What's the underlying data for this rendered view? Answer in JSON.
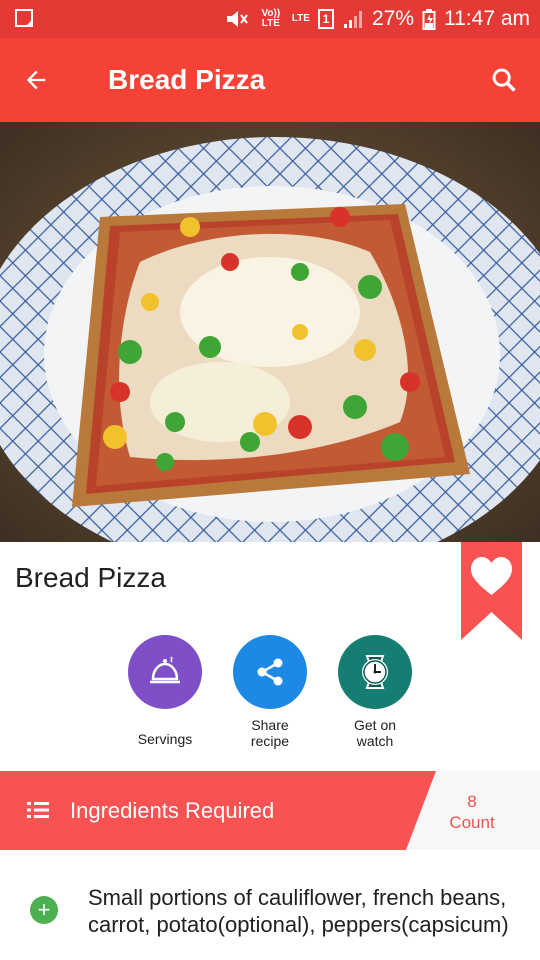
{
  "status_bar": {
    "volte": "Vo)) LTE",
    "lte": "LTE",
    "sim": "1",
    "battery": "27%",
    "time": "11:47 am"
  },
  "app_bar": {
    "title": "Bread Pizza"
  },
  "recipe": {
    "title": "Bread Pizza"
  },
  "actions": {
    "servings": "Servings",
    "share": "Share recipe",
    "watch": "Get on watch"
  },
  "ingredients": {
    "header": "Ingredients Required",
    "count_value": "8",
    "count_label": "Count",
    "items": [
      "Small portions of cauliflower, french beans, carrot, potato(optional), peppers(capsicum)"
    ]
  },
  "colors": {
    "status_bar": "#e53935",
    "app_bar": "#f44336",
    "accent": "#f95253",
    "servings": "#7e4fc7",
    "share": "#1e88e5",
    "watch": "#167d72",
    "add": "#4caf50"
  },
  "icons": [
    "screen-icon",
    "mute-icon",
    "signal-icon",
    "battery-icon",
    "back-arrow-icon",
    "search-icon",
    "heart-icon",
    "cloche-icon",
    "share-icon",
    "watch-icon",
    "list-icon",
    "plus-icon"
  ]
}
